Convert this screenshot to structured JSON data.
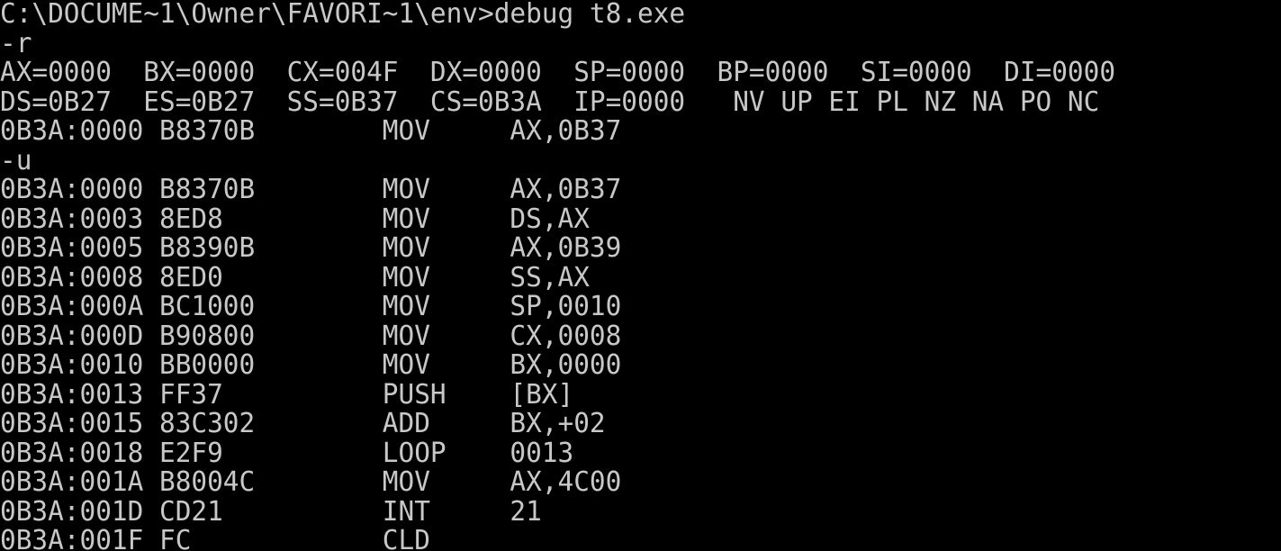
{
  "console": {
    "foreground": "#c8c8c8",
    "background": "#000000",
    "lines": [
      "C:\\DOCUME~1\\Owner\\FAVORI~1\\env>debug t8.exe",
      "-r",
      "AX=0000  BX=0000  CX=004F  DX=0000  SP=0000  BP=0000  SI=0000  DI=0000",
      "DS=0B27  ES=0B27  SS=0B37  CS=0B3A  IP=0000   NV UP EI PL NZ NA PO NC",
      "0B3A:0000 B8370B        MOV     AX,0B37",
      "-u",
      "0B3A:0000 B8370B        MOV     AX,0B37",
      "0B3A:0003 8ED8          MOV     DS,AX",
      "0B3A:0005 B8390B        MOV     AX,0B39",
      "0B3A:0008 8ED0          MOV     SS,AX",
      "0B3A:000A BC1000        MOV     SP,0010",
      "0B3A:000D B90800        MOV     CX,0008",
      "0B3A:0010 BB0000        MOV     BX,0000",
      "0B3A:0013 FF37          PUSH    [BX]",
      "0B3A:0015 83C302        ADD     BX,+02",
      "0B3A:0018 E2F9          LOOP    0013",
      "0B3A:001A B8004C        MOV     AX,4C00",
      "0B3A:001D CD21          INT     21",
      "0B3A:001F FC            CLD"
    ]
  }
}
